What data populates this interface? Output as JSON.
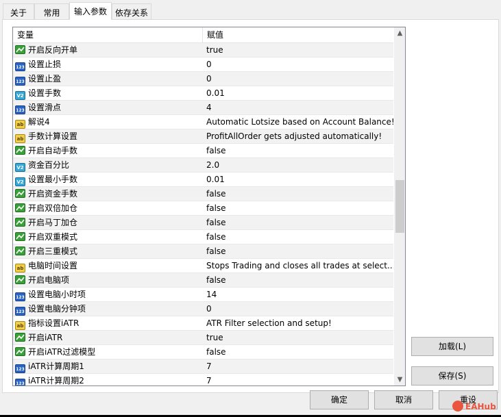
{
  "tabs": [
    {
      "label": "关于",
      "active": false
    },
    {
      "label": "常用",
      "active": false
    },
    {
      "label": "输入参数",
      "active": true
    },
    {
      "label": "依存关系",
      "active": false
    }
  ],
  "table": {
    "columns": [
      "变量",
      "赋值"
    ],
    "rows": [
      {
        "type": "bool",
        "name": "开启反向开单",
        "value": "true"
      },
      {
        "type": "int",
        "name": "设置止损",
        "value": "0"
      },
      {
        "type": "int",
        "name": "设置止盈",
        "value": "0"
      },
      {
        "type": "double",
        "name": "设置手数",
        "value": "0.01"
      },
      {
        "type": "int",
        "name": "设置滑点",
        "value": "4"
      },
      {
        "type": "string",
        "name": "解说4",
        "value": "Automatic Lotsize based on Account Balance!"
      },
      {
        "type": "string",
        "name": "手数计算设置",
        "value": "ProfitAllOrder gets adjusted automatically!"
      },
      {
        "type": "bool",
        "name": "开启自动手数",
        "value": "false"
      },
      {
        "type": "double",
        "name": "资金百分比",
        "value": "2.0"
      },
      {
        "type": "double",
        "name": "设置最小手数",
        "value": "0.01"
      },
      {
        "type": "bool",
        "name": "开启资金手数",
        "value": "false"
      },
      {
        "type": "bool",
        "name": "开启双倍加仓",
        "value": "false"
      },
      {
        "type": "bool",
        "name": "开启马丁加仓",
        "value": "false"
      },
      {
        "type": "bool",
        "name": "开启双重模式",
        "value": "false"
      },
      {
        "type": "bool",
        "name": "开启三重模式",
        "value": "false"
      },
      {
        "type": "string",
        "name": "电脑时间设置",
        "value": "Stops Trading and closes all trades at select..."
      },
      {
        "type": "bool",
        "name": "开启电脑项",
        "value": "false"
      },
      {
        "type": "int",
        "name": "设置电脑小时项",
        "value": "14"
      },
      {
        "type": "int",
        "name": "设置电脑分钟项",
        "value": "0"
      },
      {
        "type": "string",
        "name": "指标设置iATR",
        "value": "ATR Filter selection and setup!"
      },
      {
        "type": "bool",
        "name": "开启iATR",
        "value": "true"
      },
      {
        "type": "bool",
        "name": "开启iATR过滤模型",
        "value": "false"
      },
      {
        "type": "int",
        "name": "iATR计算周期1",
        "value": "7"
      },
      {
        "type": "int",
        "name": "iATR计算周期2",
        "value": "7"
      }
    ]
  },
  "icons": {
    "bool": "bool-param-icon",
    "int": "int-param-icon",
    "double": "double-param-icon",
    "string": "string-param-icon",
    "int_text": "123",
    "double_text": "V2",
    "string_text": "ab"
  },
  "scrollbar": {
    "up": "▲",
    "down": "▼",
    "position": 0.5
  },
  "buttons": {
    "load": "加载(L)",
    "save": "保存(S)",
    "ok": "确定",
    "cancel": "取消",
    "reset": "重设"
  },
  "watermark": "EAHub",
  "colors": {
    "bool": "#3aa13a",
    "int": "#2a64c4",
    "double": "#36a8d8",
    "string": "#f2cf4a"
  }
}
